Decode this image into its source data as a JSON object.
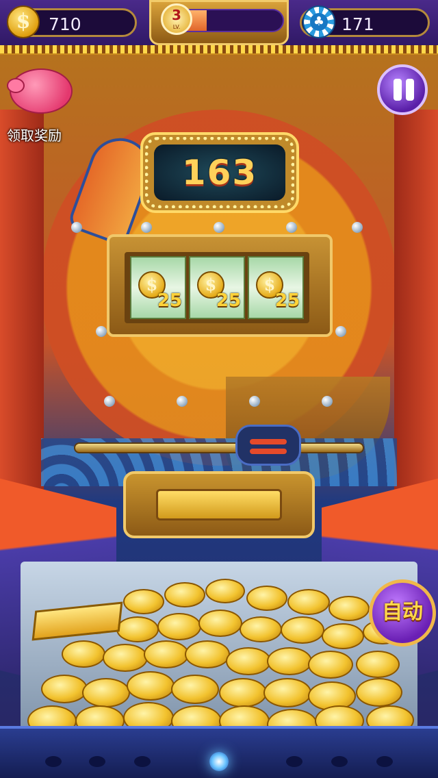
{
  "hud": {
    "coins": "710",
    "level": "3",
    "level_suffix": "LV.",
    "level_progress": 0.3,
    "chips": "171",
    "coin_icon": "dollar-coin-icon",
    "chip_icon": "club-chip-icon"
  },
  "reward": {
    "label": "领取奖励",
    "icon": "piggy-bank-icon"
  },
  "pause": {
    "icon": "pause-icon"
  },
  "score": {
    "value": "163"
  },
  "reels": [
    {
      "value": "25",
      "icon": "coin-stack-icon"
    },
    {
      "value": "25",
      "icon": "coin-stack-icon"
    },
    {
      "value": "25",
      "icon": "coin-stack-icon"
    }
  ],
  "auto_button": {
    "label": "自动"
  },
  "colors": {
    "gold": "#f2c22e",
    "purple": "#6a1fb4",
    "navy": "#213266"
  }
}
